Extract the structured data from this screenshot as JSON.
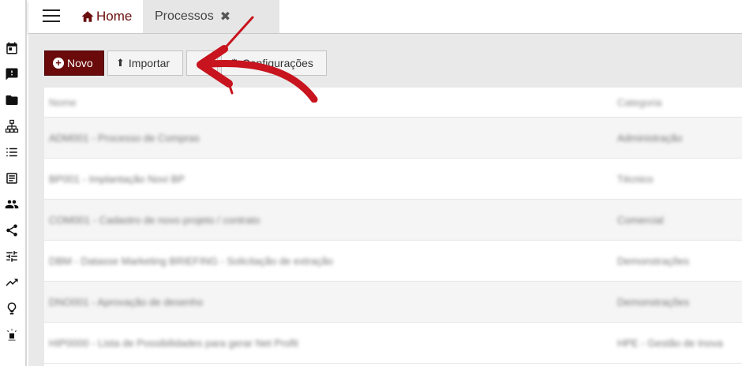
{
  "rail": {
    "icons": [
      "calendar-icon",
      "feedback-icon",
      "folder-icon",
      "sitemap-icon",
      "list-icon",
      "article-icon",
      "people-icon",
      "share-icon",
      "tune-icon",
      "trending-up-icon",
      "lightbulb-icon",
      "robot-icon"
    ]
  },
  "header": {
    "home_label": "Home",
    "tab_label": "Processos",
    "close_glyph": "✖"
  },
  "toolbar": {
    "novo_label": "Novo",
    "importar_label": "Importar",
    "config_label": "Configurações"
  },
  "table": {
    "columns": [
      "Nome",
      "Categoria"
    ],
    "rows": [
      {
        "nome": "ADM001 - Processo de Compras",
        "categoria": "Administração"
      },
      {
        "nome": "BP001 - Implantação Novi BP",
        "categoria": "Técnico"
      },
      {
        "nome": "COM001 - Cadastro de novo projeto / contrato",
        "categoria": "Comercial"
      },
      {
        "nome": "DBM - Datasse Marketing BRIEFING - Solicitação de extração",
        "categoria": "Demonstrações"
      },
      {
        "nome": "DNO001 - Aprovação de desenho",
        "categoria": "Demonstrações"
      },
      {
        "nome": "HIP0000 - Lista de Possibilidades para gerar Net Profit",
        "categoria": "HPE - Gestão de Inova"
      }
    ]
  },
  "colors": {
    "brand": "#6a0a0a",
    "arrow": "#c8141e"
  }
}
